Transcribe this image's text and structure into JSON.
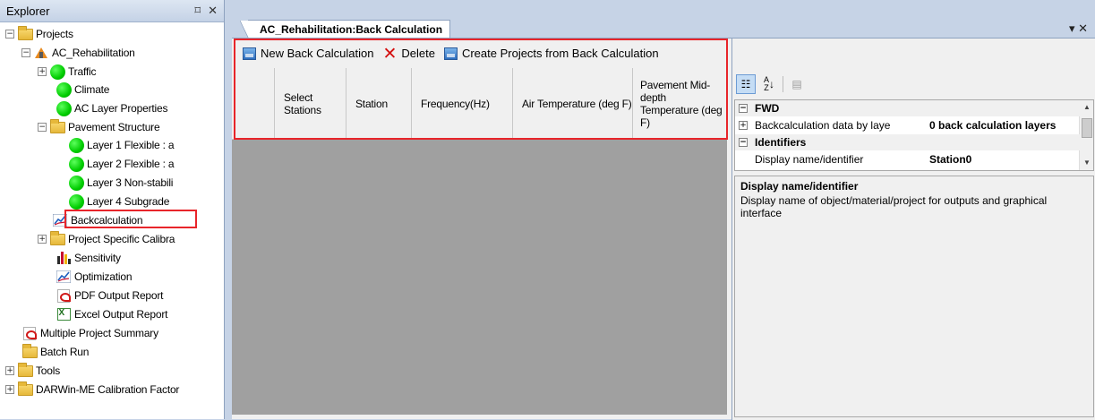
{
  "explorer": {
    "title": "Explorer",
    "pin_glyph": "⌑",
    "close_glyph": "✕",
    "tree": [
      {
        "label": "Projects",
        "expander": "−",
        "icon": "folder"
      },
      {
        "label": "AC_Rehabilitation",
        "expander": "−",
        "icon": "project"
      },
      {
        "label": "Traffic",
        "expander": "+",
        "icon": "green-dot"
      },
      {
        "label": "Climate",
        "expander": "",
        "icon": "green-dot"
      },
      {
        "label": "AC Layer Properties",
        "expander": "",
        "icon": "green-dot"
      },
      {
        "label": "Pavement Structure",
        "expander": "−",
        "icon": "folder"
      },
      {
        "label": "Layer 1 Flexible : a",
        "expander": "",
        "icon": "green-dot"
      },
      {
        "label": "Layer 2 Flexible : a",
        "expander": "",
        "icon": "green-dot"
      },
      {
        "label": "Layer 3 Non-stabili",
        "expander": "",
        "icon": "green-dot"
      },
      {
        "label": "Layer 4 Subgrade",
        "expander": "",
        "icon": "green-dot"
      },
      {
        "label": "Backcalculation",
        "expander": "",
        "icon": "graph"
      },
      {
        "label": "Project Specific Calibra",
        "expander": "+",
        "icon": "folder"
      },
      {
        "label": "Sensitivity",
        "expander": "",
        "icon": "bars"
      },
      {
        "label": "Optimization",
        "expander": "",
        "icon": "graph"
      },
      {
        "label": "PDF Output Report",
        "expander": "",
        "icon": "pdf"
      },
      {
        "label": "Excel Output Report",
        "expander": "",
        "icon": "excel"
      },
      {
        "label": "Multiple Project Summary",
        "expander": "",
        "icon": "pdf"
      },
      {
        "label": "Batch Run",
        "expander": "",
        "icon": "folder"
      },
      {
        "label": "Tools",
        "expander": "+",
        "icon": "folder"
      },
      {
        "label": "DARWin-ME Calibration Factor",
        "expander": "+",
        "icon": "folder"
      }
    ]
  },
  "document": {
    "tab_label": "AC_Rehabilitation:Back Calculation",
    "window_controls": "▾ ✕",
    "toolbar": {
      "new_label": "New Back Calculation",
      "delete_label": "Delete",
      "create_label": "Create Projects from Back Calculation"
    },
    "grid": {
      "columns": [
        "",
        "Select Stations",
        "Station",
        "Frequency(Hz)",
        "Air Temperature (deg F)",
        "Pavement Mid-depth Temperature (deg F)"
      ],
      "rows": []
    }
  },
  "properties": {
    "categorized_glyph": "☷",
    "alphabetical_glyph": "↓",
    "pages_glyph": "▤",
    "rows": [
      {
        "type": "category",
        "expander": "−",
        "name": "FWD",
        "value": ""
      },
      {
        "type": "property",
        "expander": "+",
        "name": "Backcalculation data by laye",
        "value": "0 back calculation layers"
      },
      {
        "type": "category",
        "expander": "−",
        "name": "Identifiers",
        "value": ""
      },
      {
        "type": "property",
        "expander": "",
        "name": "Display name/identifier",
        "value": "Station0"
      }
    ],
    "help": {
      "title": "Display name/identifier",
      "description": "Display name of object/material/project for outputs and graphical interface"
    }
  },
  "colors": {
    "highlight": "#e8252a",
    "grid_background": "#a0a0a0",
    "status_ok": "#00cc00"
  }
}
